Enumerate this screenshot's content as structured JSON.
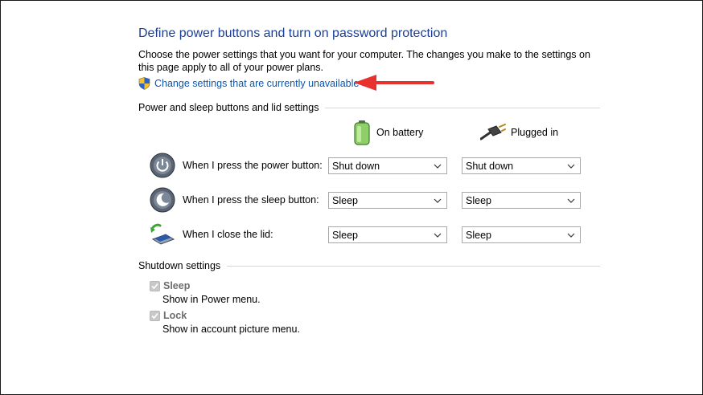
{
  "page": {
    "title": "Define power buttons and turn on password protection",
    "description": "Choose the power settings that you want for your computer. The changes you make to the settings on this page apply to all of your power plans.",
    "change_settings_link": "Change settings that are currently unavailable"
  },
  "power_section": {
    "heading": "Power and sleep buttons and lid settings",
    "columns": {
      "on_battery": "On battery",
      "plugged_in": "Plugged in"
    },
    "rows": [
      {
        "label": "When I press the power button:",
        "on_battery": "Shut down",
        "plugged_in": "Shut down",
        "icon": "power-button-icon"
      },
      {
        "label": "When I press the sleep button:",
        "on_battery": "Sleep",
        "plugged_in": "Sleep",
        "icon": "sleep-button-icon"
      },
      {
        "label": "When I close the lid:",
        "on_battery": "Sleep",
        "plugged_in": "Sleep",
        "icon": "laptop-lid-icon"
      }
    ]
  },
  "shutdown_section": {
    "heading": "Shutdown settings",
    "items": [
      {
        "label": "Sleep",
        "checked": true,
        "disabled": true,
        "description": "Show in Power menu."
      },
      {
        "label": "Lock",
        "checked": true,
        "disabled": true,
        "description": "Show in account picture menu."
      }
    ]
  },
  "colors": {
    "title": "#1c3f94",
    "link": "#0b57b0",
    "annotation_arrow": "#e8322d",
    "disabled_text": "#6d6d6d"
  }
}
